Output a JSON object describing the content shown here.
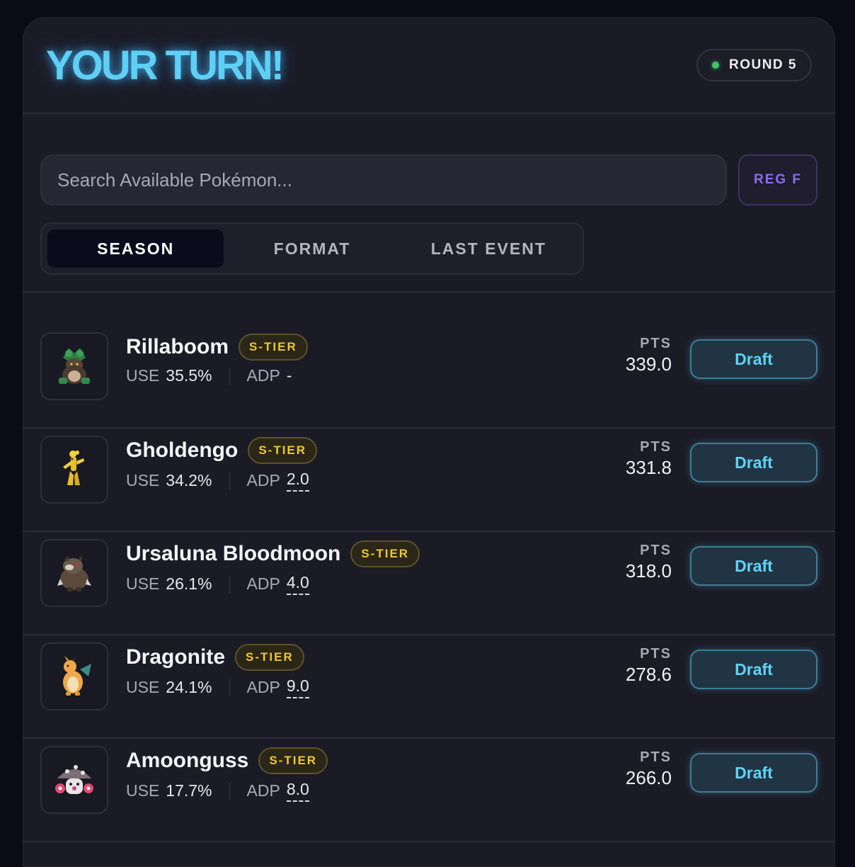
{
  "header": {
    "title": "YOUR TURN!",
    "round_label": "ROUND 5"
  },
  "search": {
    "placeholder": "Search Available Pokémon...",
    "value": ""
  },
  "regulation_button": "REG F",
  "tabs": [
    {
      "label": "SEASON",
      "active": true
    },
    {
      "label": "FORMAT",
      "active": false
    },
    {
      "label": "LAST EVENT",
      "active": false
    }
  ],
  "players": [
    {
      "name": "Rillaboom",
      "tier": "S-TIER",
      "use_label": "USE",
      "use": "35.5%",
      "adp_label": "ADP",
      "adp": "-",
      "pts_label": "PTS",
      "pts": "339.0",
      "draft_label": "Draft"
    },
    {
      "name": "Gholdengo",
      "tier": "S-TIER",
      "use_label": "USE",
      "use": "34.2%",
      "adp_label": "ADP",
      "adp": "2.0",
      "pts_label": "PTS",
      "pts": "331.8",
      "draft_label": "Draft"
    },
    {
      "name": "Ursaluna Bloodmoon",
      "tier": "S-TIER",
      "use_label": "USE",
      "use": "26.1%",
      "adp_label": "ADP",
      "adp": "4.0",
      "pts_label": "PTS",
      "pts": "318.0",
      "draft_label": "Draft"
    },
    {
      "name": "Dragonite",
      "tier": "S-TIER",
      "use_label": "USE",
      "use": "24.1%",
      "adp_label": "ADP",
      "adp": "9.0",
      "pts_label": "PTS",
      "pts": "278.6",
      "draft_label": "Draft"
    },
    {
      "name": "Amoonguss",
      "tier": "S-TIER",
      "use_label": "USE",
      "use": "17.7%",
      "adp_label": "ADP",
      "adp": "8.0",
      "pts_label": "PTS",
      "pts": "266.0",
      "draft_label": "Draft"
    }
  ],
  "colors": {
    "accent_cyan": "#60cff6",
    "tier_gold": "#f0c830",
    "status_green": "#39c568",
    "reg_purple": "#8b6cf0"
  }
}
